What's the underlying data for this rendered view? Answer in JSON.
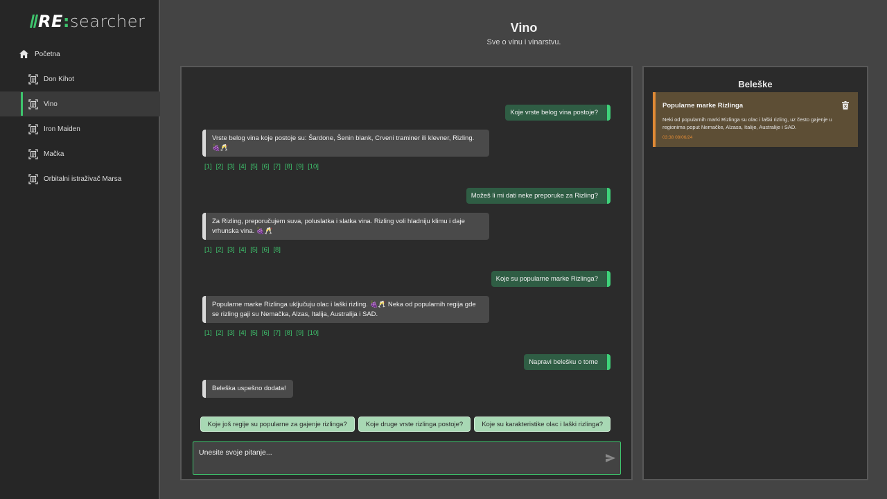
{
  "app": {
    "logo_re": "RE",
    "logo_colon": ":",
    "logo_rest": "searcher"
  },
  "sidebar": {
    "home_label": "Početna",
    "items": [
      {
        "label": "Don Kihot"
      },
      {
        "label": "Vino"
      },
      {
        "label": "Iron Maiden"
      },
      {
        "label": "Mačka"
      },
      {
        "label": "Orbitalni istraživač Marsa"
      }
    ],
    "active_index": 1
  },
  "header": {
    "title": "Vino",
    "subtitle": "Sve o vinu i vinarstvu."
  },
  "chat": {
    "messages": [
      {
        "role": "user",
        "text": "Koje vrste belog vina postoje?"
      },
      {
        "role": "bot",
        "text": "Vrste belog vina koje postoje su: Šardone, Šenin blank, Crveni traminer ili klevner, Rizling.",
        "emoji": "🍇🥂",
        "citations": [
          "[1]",
          "[2]",
          "[3]",
          "[4]",
          "[5]",
          "[6]",
          "[7]",
          "[8]",
          "[9]",
          "[10]"
        ]
      },
      {
        "role": "user",
        "text": "Možeš li mi dati neke preporuke za Rizling?"
      },
      {
        "role": "bot",
        "text": "Za Rizling, preporučujem suva, poluslatka i slatka vina. Rizling voli hladniju klimu i daje vrhunska vina.",
        "emoji": "🍇🥂",
        "citations": [
          "[1]",
          "[2]",
          "[3]",
          "[4]",
          "[5]",
          "[6]",
          "[8]"
        ]
      },
      {
        "role": "user",
        "text": "Koje su popularne marke Rizlinga?"
      },
      {
        "role": "bot",
        "text_a": "Popularne marke Rizlinga uključuju olac i laški rizling.",
        "emoji": "🍇🥂",
        "text_b": "Neka od popularnih regija gde se rizling gaji su Nemačka, Alzas, Italija, Australija i SAD.",
        "citations": [
          "[1]",
          "[2]",
          "[3]",
          "[4]",
          "[5]",
          "[6]",
          "[7]",
          "[8]",
          "[9]",
          "[10]"
        ]
      },
      {
        "role": "user",
        "text": "Napravi belešku o tome"
      },
      {
        "role": "bot",
        "text": "Beleška uspešno dodata!"
      }
    ],
    "suggestions": [
      "Koje još regije su popularne za gajenje rizlinga?",
      "Koje druge vrste rizlinga postoje?",
      "Koje su karakteristike olac i laški rizlinga?"
    ],
    "input_placeholder": "Unesite svoje pitanje..."
  },
  "notes": {
    "title": "Beleške",
    "items": [
      {
        "title": "Popularne marke Rizlinga",
        "body": "Neki od popularnih marki Rizlinga su olac i laški rizling, uz često gajenje u regionima poput Nemačke, Alzasa, Italije, Australije i SAD.",
        "date": "03:38 08/06/24"
      }
    ]
  },
  "colors": {
    "accent": "#3ec46d",
    "note_accent": "#e08a35",
    "background": "#444444",
    "panel": "#2b2b2b",
    "sidebar": "#262626"
  },
  "icons": {
    "home": "home-icon",
    "topic": "document-scan-icon",
    "send": "send-icon",
    "delete": "trash-icon"
  }
}
